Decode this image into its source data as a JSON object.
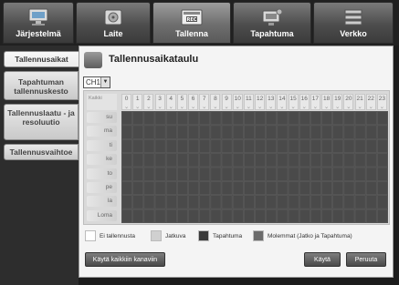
{
  "nav": {
    "tabs": [
      {
        "label": "Järjestelmä",
        "icon": "monitor-icon",
        "active": false
      },
      {
        "label": "Laite",
        "icon": "hard-drive-icon",
        "active": false
      },
      {
        "label": "Tallenna",
        "icon": "rec-icon",
        "active": true
      },
      {
        "label": "Tapahtuma",
        "icon": "event-monitor-icon",
        "active": false
      },
      {
        "label": "Verkko",
        "icon": "network-icon",
        "active": false
      }
    ]
  },
  "sidebar": {
    "items": [
      {
        "label": "Tallennusaikat",
        "active": true
      },
      {
        "label": "Tapahtuman tallennuskesto",
        "active": false
      },
      {
        "label": "Tallennuslaatu - ja resoluutio",
        "active": false
      },
      {
        "label": "Tallennusvaihtoe",
        "active": false
      }
    ]
  },
  "main": {
    "title": "Tallennusaikataulu",
    "title_icon": "schedule-icon",
    "channel_select": "CH1",
    "grid": {
      "corner_label": "Kaikki",
      "hours": [
        "0",
        "1",
        "2",
        "3",
        "4",
        "5",
        "6",
        "7",
        "8",
        "9",
        "10",
        "11",
        "12",
        "13",
        "14",
        "15",
        "16",
        "17",
        "18",
        "19",
        "20",
        "21",
        "22",
        "23"
      ],
      "days": [
        "su",
        "ma",
        "ti",
        "ke",
        "to",
        "pe",
        "la",
        "Loma"
      ],
      "cell_color": "#4a4a4a"
    },
    "legend": [
      {
        "label": "Ei tallennusta",
        "color": "#ffffff"
      },
      {
        "label": "Jatkuva",
        "color": "#d0d0d0"
      },
      {
        "label": "Tapahtuma",
        "color": "#3a3a3a"
      },
      {
        "label": "Molemmat (Jatko ja Tapahtuma)",
        "color": "#6b6b6b"
      }
    ],
    "buttons": {
      "apply_all": "Käytä kaikkiin kanaviin",
      "apply": "Käytä",
      "cancel": "Peruuta"
    }
  }
}
